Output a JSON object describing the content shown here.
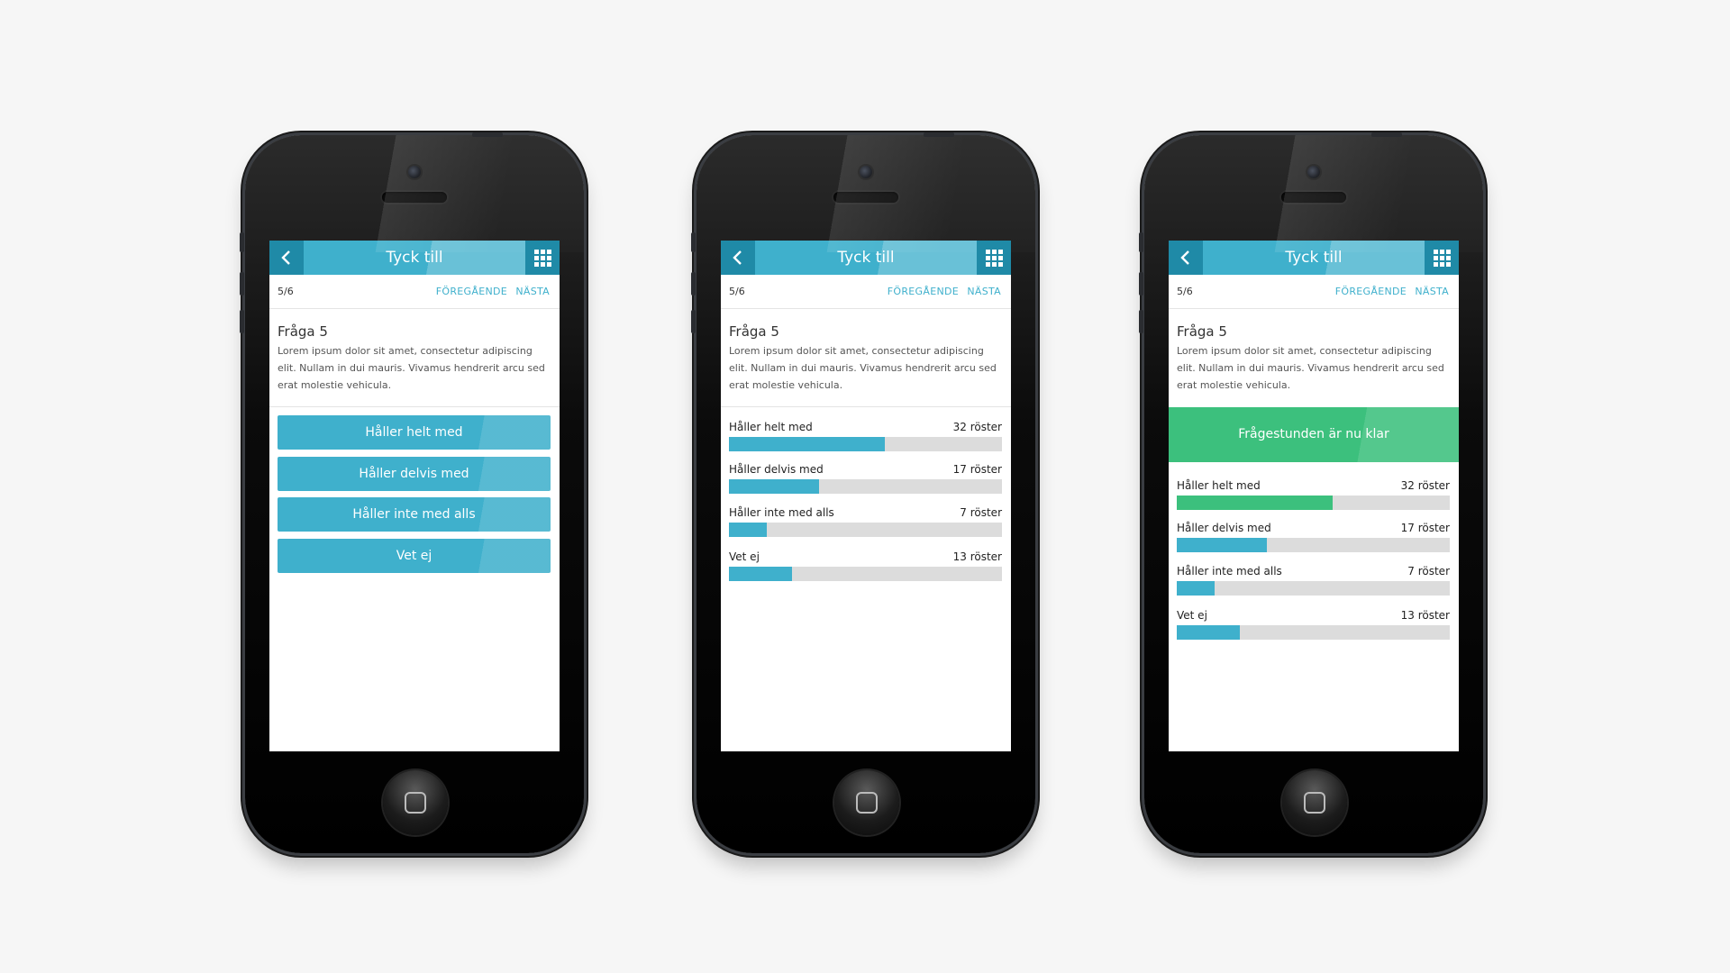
{
  "colors": {
    "background": "#f6f6f6",
    "accent": "#3fb0cc",
    "accent_dark": "#1f8aa7",
    "success": "#3cc07d",
    "track": "#dcdcdc"
  },
  "phones": [
    {
      "header": {
        "title": "Tyck till",
        "back_icon": "chevron-left-icon",
        "menu_icon": "grid-icon"
      },
      "nav": {
        "count": "5/6",
        "prev": "FÖREGÅENDE",
        "next": "NÄSTA"
      },
      "question": {
        "title": "Fråga 5",
        "text": "Lorem ipsum dolor sit amet, consectetur adipiscing elit. Nullam in dui mauris. Vivamus hendrerit arcu sed erat molestie vehicula."
      },
      "options": [
        "Håller helt med",
        "Håller delvis med",
        "Håller inte med alls",
        "Vet ej"
      ]
    },
    {
      "header": {
        "title": "Tyck till",
        "back_icon": "chevron-left-icon",
        "menu_icon": "grid-icon"
      },
      "nav": {
        "count": "5/6",
        "prev": "FÖREGÅENDE",
        "next": "NÄSTA"
      },
      "question": {
        "title": "Fråga 5",
        "text": "Lorem ipsum dolor sit amet, consectetur adipiscing elit. Nullam in dui mauris. Vivamus hendrerit arcu sed erat molestie vehicula."
      },
      "results": [
        {
          "label": "Håller helt med",
          "votes": "32 röster",
          "share": 0.57
        },
        {
          "label": "Håller delvis med",
          "votes": "17 röster",
          "share": 0.33
        },
        {
          "label": "Håller inte med alls",
          "votes": "7 röster",
          "share": 0.14
        },
        {
          "label": "Vet ej",
          "votes": "13 röster",
          "share": 0.23
        }
      ]
    },
    {
      "header": {
        "title": "Tyck till",
        "back_icon": "chevron-left-icon",
        "menu_icon": "grid-icon"
      },
      "nav": {
        "count": "5/6",
        "prev": "FÖREGÅENDE",
        "next": "NÄSTA"
      },
      "question": {
        "title": "Fråga 5",
        "text": "Lorem ipsum dolor sit amet, consectetur adipiscing elit. Nullam in dui mauris. Vivamus hendrerit arcu sed erat molestie vehicula."
      },
      "banner": "Frågestunden är nu klar",
      "results": [
        {
          "label": "Håller helt med",
          "votes": "32 röster",
          "share": 0.57,
          "highlight": true
        },
        {
          "label": "Håller delvis med",
          "votes": "17 röster",
          "share": 0.33
        },
        {
          "label": "Håller inte med alls",
          "votes": "7 röster",
          "share": 0.14
        },
        {
          "label": "Vet ej",
          "votes": "13 röster",
          "share": 0.23
        }
      ]
    }
  ]
}
